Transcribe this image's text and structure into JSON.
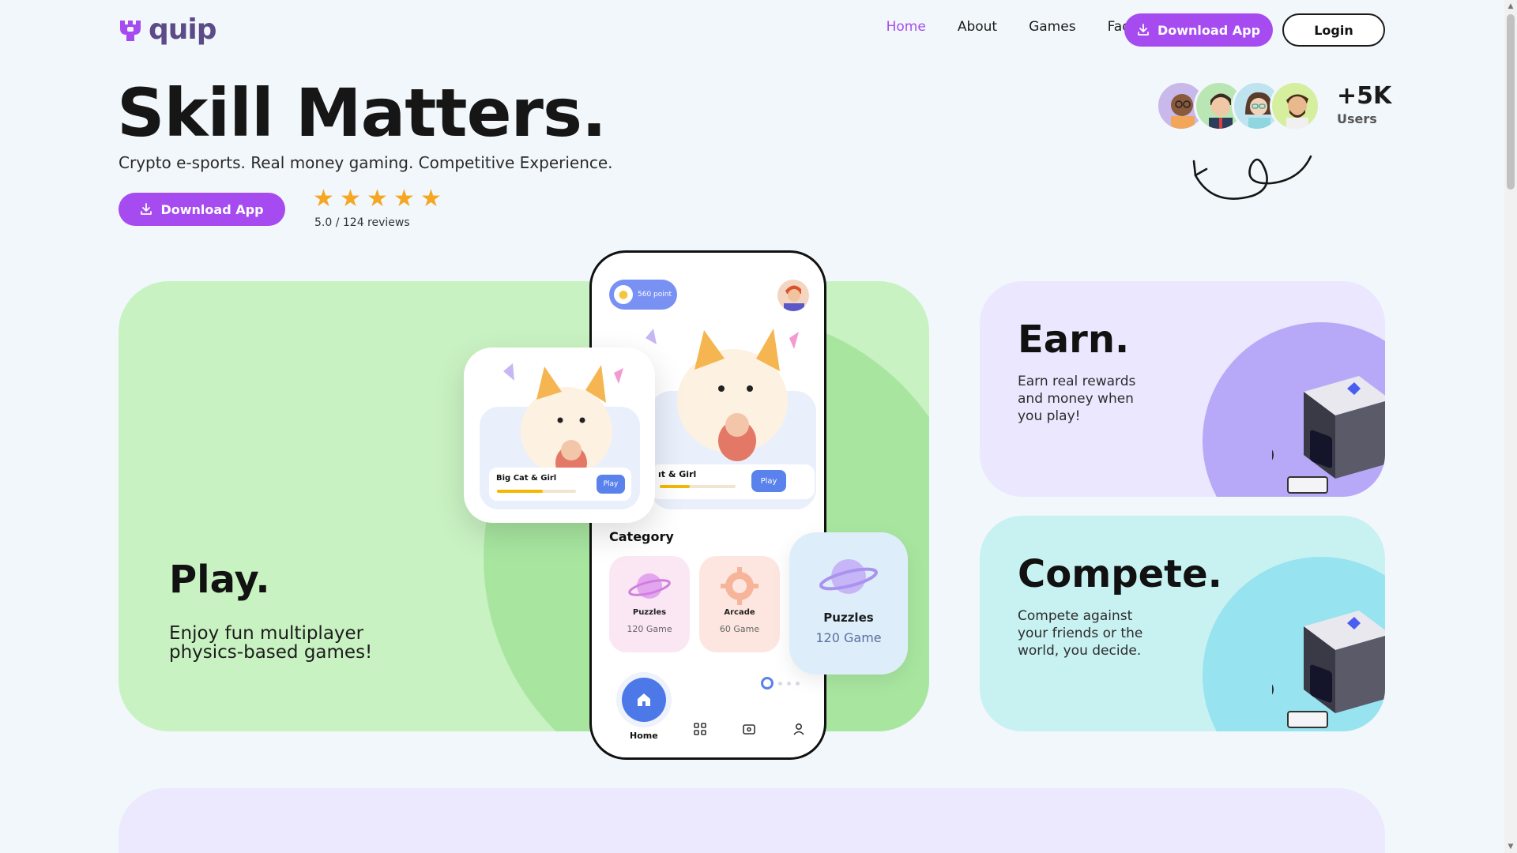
{
  "brand": {
    "name": "quip",
    "accent": "#a64bf0",
    "logo_color": "#5c4b86"
  },
  "nav": {
    "links": [
      {
        "label": "Home",
        "active": true
      },
      {
        "label": "About",
        "active": false
      },
      {
        "label": "Games",
        "active": false
      },
      {
        "label": "Faq",
        "active": false
      }
    ],
    "download_label": "Download App",
    "login_label": "Login"
  },
  "hero": {
    "title": "Skill Matters.",
    "subtitle": "Crypto e-sports. Real money gaming. Competitive Experience.",
    "download_label": "Download App",
    "rating": 5,
    "reviews_text": "5.0 / 124 reviews"
  },
  "users": {
    "count": "+5K",
    "label": "Users"
  },
  "play_card": {
    "title": "Play.",
    "description": "Enjoy fun multiplayer physics-based games!",
    "bg": "#c9f2c2"
  },
  "earn_card": {
    "title": "Earn.",
    "description": "Earn real rewards and money when you play!",
    "bg": "#ebe7fe"
  },
  "compete_card": {
    "title": "Compete.",
    "description": "Compete against your friends or the world, you decide.",
    "bg": "#c8f1f1"
  },
  "phone": {
    "points": "560 point",
    "feature_game": "Big Cat & Girl",
    "feature_game_visible": "ıt & Girl",
    "feature_progress": 0.4,
    "play_label": "Play",
    "category_title": "Category",
    "categories": [
      {
        "name": "Puzzles",
        "count": "120 Game",
        "bg": "#fbe6f4"
      },
      {
        "name": "Arcade",
        "count": "60 Game",
        "bg": "#fde6df"
      }
    ],
    "home_label": "Home"
  },
  "popup_card": {
    "game": "Big Cat & Girl",
    "play_label": "Play",
    "progress": 0.58
  },
  "float_tile": {
    "name": "Puzzles",
    "count": "120 Game"
  },
  "icons": [
    "logo-icon",
    "download-icon",
    "star-icon",
    "arrow-scribble-icon",
    "coin-icon",
    "home-icon",
    "grid-icon",
    "ticket-icon",
    "user-icon",
    "planet-icon",
    "gear-icon"
  ]
}
